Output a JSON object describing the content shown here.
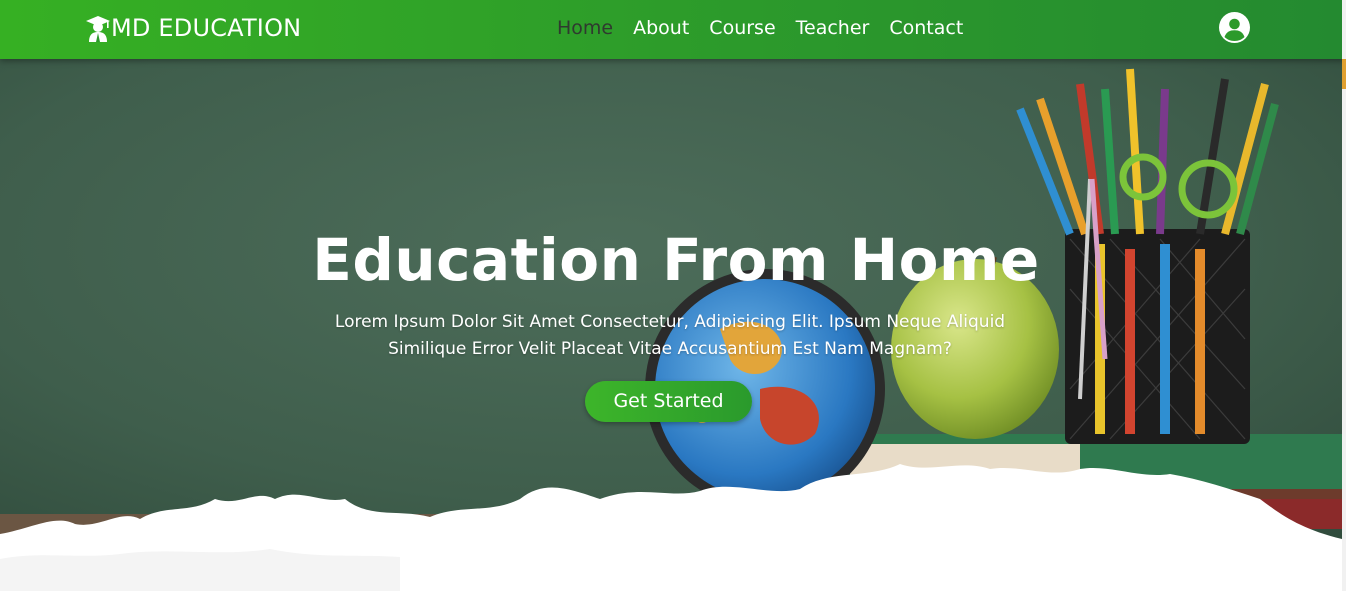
{
  "header": {
    "brand": "MD EDUCATION",
    "logo_icon": "graduate-icon",
    "nav": [
      {
        "label": "Home",
        "active": true
      },
      {
        "label": "About",
        "active": false
      },
      {
        "label": "Course",
        "active": false
      },
      {
        "label": "Teacher",
        "active": false
      },
      {
        "label": "Contact",
        "active": false
      }
    ],
    "user_icon": "user-circle-icon"
  },
  "hero": {
    "title": "Education From Home",
    "subtitle_line1": "Lorem Ipsum Dolor Sit Amet Consectetur, Adipisicing Elit. Ipsum Neque Aliquid",
    "subtitle_line2": "Similique Error Velit Placeat Vitae Accusantium Est Nam Magnam?",
    "cta_label": "Get Started"
  },
  "colors": {
    "header_green": "#2c9a2b",
    "accent_green": "#36b023",
    "chalkboard": "#3f5e4c",
    "active_nav": "#2f3a2f"
  }
}
